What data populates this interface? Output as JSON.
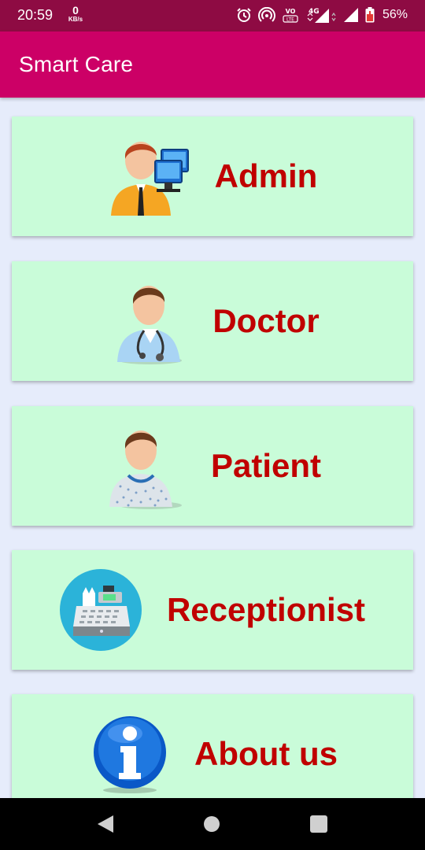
{
  "status_bar": {
    "time": "20:59",
    "net_speed_value": "0",
    "net_speed_unit": "KB/s",
    "battery": "56%",
    "icons": [
      "alarm-icon",
      "hotspot-icon",
      "volte-icon",
      "signal-4g-icon",
      "signal-icon",
      "battery-icon"
    ]
  },
  "app_bar": {
    "title": "Smart Care"
  },
  "menu": [
    {
      "label": "Admin",
      "icon": "admin-icon"
    },
    {
      "label": "Doctor",
      "icon": "doctor-icon"
    },
    {
      "label": "Patient",
      "icon": "patient-icon"
    },
    {
      "label": "Receptionist",
      "icon": "receptionist-icon"
    },
    {
      "label": "About us",
      "icon": "info-icon"
    }
  ],
  "nav_bar": {
    "buttons": [
      "back-icon",
      "home-icon",
      "recents-icon"
    ]
  },
  "colors": {
    "status_bar": "#8e0b43",
    "app_bar": "#cc0066",
    "background": "#e6ecfb",
    "card": "#c9fcd9",
    "label": "#c00000"
  }
}
